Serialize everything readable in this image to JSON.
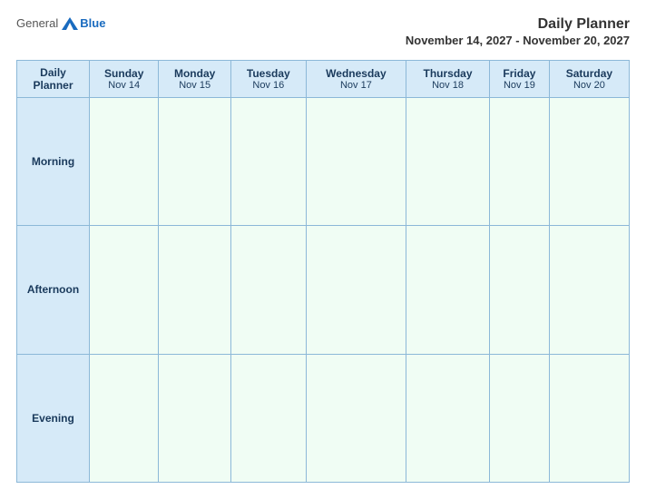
{
  "header": {
    "logo_general": "General",
    "logo_blue": "Blue",
    "title": "Daily Planner",
    "date_range": "November 14, 2027 - November 20, 2027"
  },
  "table": {
    "corner_line1": "Daily",
    "corner_line2": "Planner",
    "columns": [
      {
        "name": "Sunday",
        "date": "Nov 14"
      },
      {
        "name": "Monday",
        "date": "Nov 15"
      },
      {
        "name": "Tuesday",
        "date": "Nov 16"
      },
      {
        "name": "Wednesday",
        "date": "Nov 17"
      },
      {
        "name": "Thursday",
        "date": "Nov 18"
      },
      {
        "name": "Friday",
        "date": "Nov 19"
      },
      {
        "name": "Saturday",
        "date": "Nov 20"
      }
    ],
    "rows": [
      {
        "label": "Morning"
      },
      {
        "label": "Afternoon"
      },
      {
        "label": "Evening"
      }
    ]
  }
}
